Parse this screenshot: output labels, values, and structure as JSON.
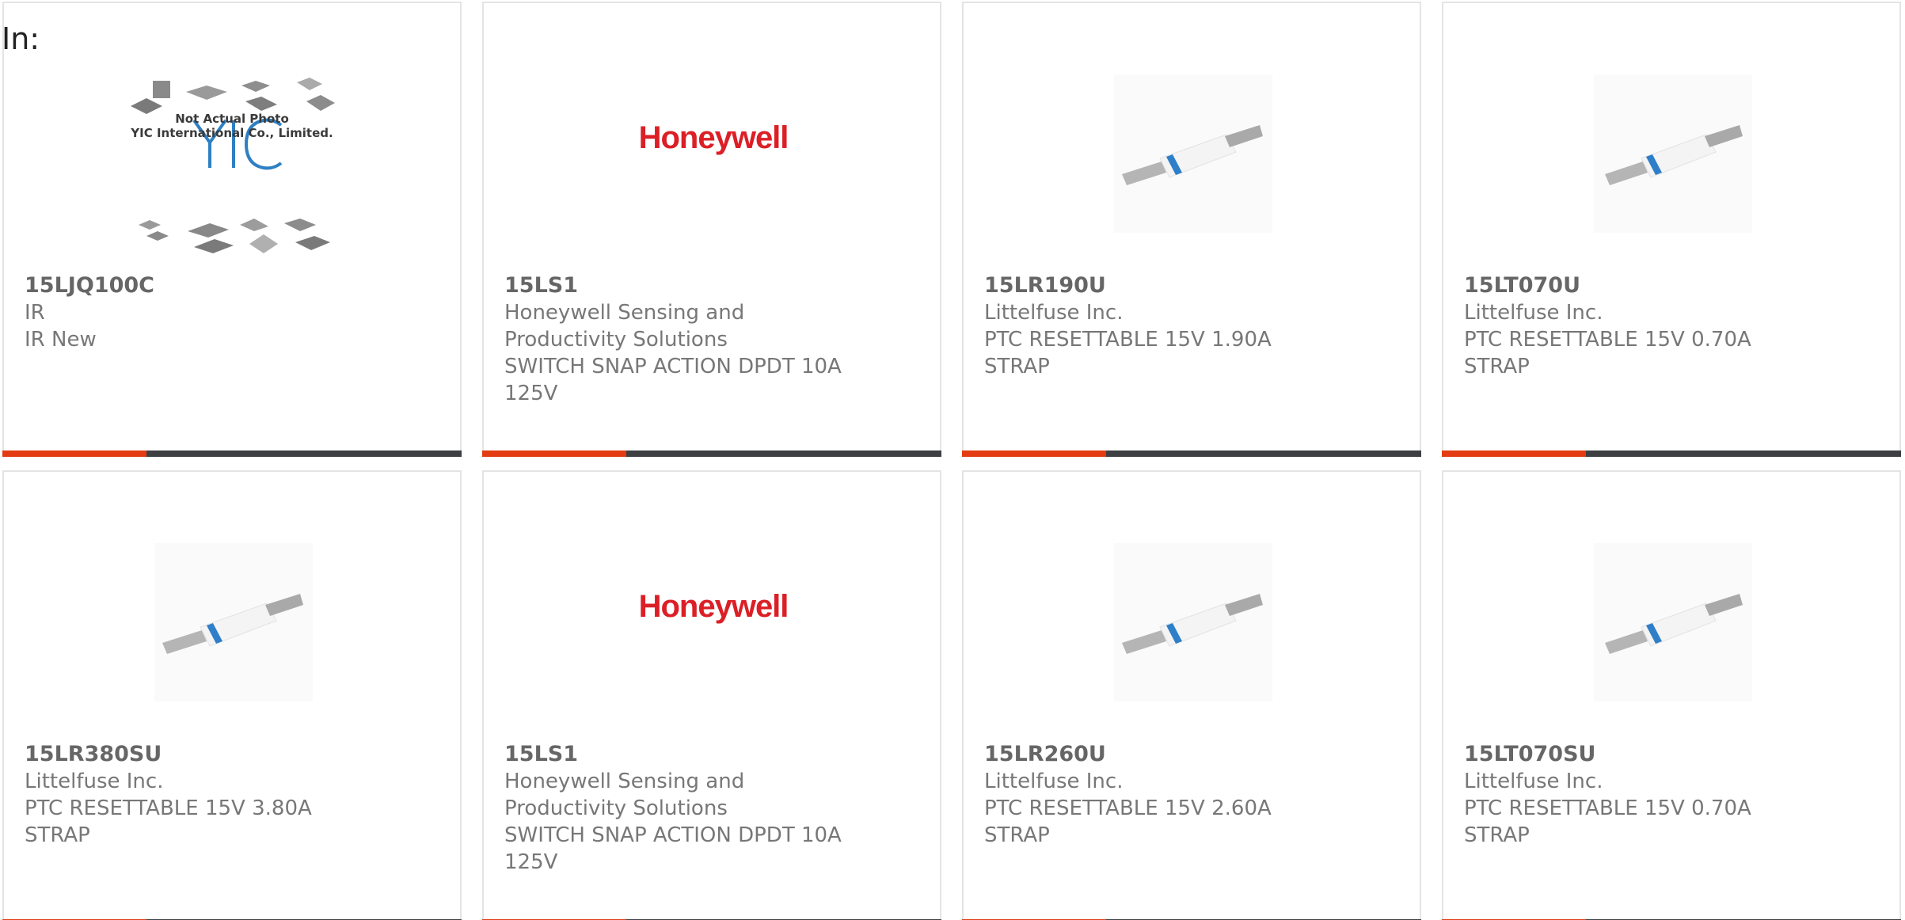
{
  "header": {
    "label": "In:"
  },
  "cards": [
    {
      "part": "15LJQ100C",
      "maker": "IR",
      "desc": "IR New",
      "image": "yic-placeholder",
      "placeholder_line1": "Not Actual Photo",
      "placeholder_line2": "YIC International Co., Limited."
    },
    {
      "part": "15LS1",
      "maker": "Honeywell Sensing and Productivity Solutions",
      "desc": "SWITCH SNAP ACTION DPDT 10A 125V",
      "image": "honeywell-logo",
      "logo_text": "Honeywell"
    },
    {
      "part": "15LR190U",
      "maker": "Littelfuse Inc.",
      "desc": "PTC RESETTABLE 15V 1.90A STRAP",
      "image": "strap-fuse"
    },
    {
      "part": "15LT070U",
      "maker": "Littelfuse Inc.",
      "desc": "PTC RESETTABLE 15V 0.70A STRAP",
      "image": "strap-fuse"
    },
    {
      "part": "15LR380SU",
      "maker": "Littelfuse Inc.",
      "desc": "PTC RESETTABLE 15V 3.80A STRAP",
      "image": "strap-fuse"
    },
    {
      "part": "15LS1",
      "maker": "Honeywell Sensing and Productivity Solutions",
      "desc": "SWITCH SNAP ACTION DPDT 10A 125V",
      "image": "honeywell-logo",
      "logo_text": "Honeywell"
    },
    {
      "part": "15LR260U",
      "maker": "Littelfuse Inc.",
      "desc": "PTC RESETTABLE 15V 2.60A STRAP",
      "image": "strap-fuse"
    },
    {
      "part": "15LT070SU",
      "maker": "Littelfuse Inc.",
      "desc": "PTC RESETTABLE 15V 0.70A STRAP",
      "image": "strap-fuse"
    }
  ],
  "colors": {
    "accent": "#e33c12",
    "bar": "#3e3f43",
    "brand_logo": "#dc1f26",
    "fuse_band": "#2f7fc8"
  }
}
